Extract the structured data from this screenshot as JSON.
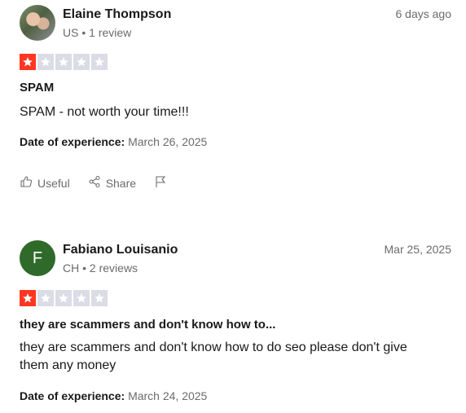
{
  "colors": {
    "star_filled": "#ff3722",
    "star_empty": "#dcdce6",
    "avatar_f": "#2f6a2a"
  },
  "reviews": [
    {
      "reviewer": {
        "name": "Elaine Thompson",
        "country": "US",
        "review_count": "1 review",
        "avatar_letter": ""
      },
      "posted": "6 days ago",
      "rating": 1,
      "title": "SPAM",
      "body": "SPAM - not worth your time!!!",
      "experience_label": "Date of experience:",
      "experience_date": "March 26, 2025",
      "useful_label": "Useful",
      "share_label": "Share",
      "icons": [
        "thumbs-up-icon",
        "share-icon",
        "flag-icon"
      ]
    },
    {
      "reviewer": {
        "name": "Fabiano Louisanio",
        "country": "CH",
        "review_count": "2 reviews",
        "avatar_letter": "F"
      },
      "posted": "Mar 25, 2025",
      "rating": 1,
      "title": "they are scammers and don't know how to...",
      "body": "they are scammers and don't know how to do seo please don't give them any money",
      "experience_label": "Date of experience:",
      "experience_date": "March 24, 2025"
    }
  ],
  "separator": "•"
}
